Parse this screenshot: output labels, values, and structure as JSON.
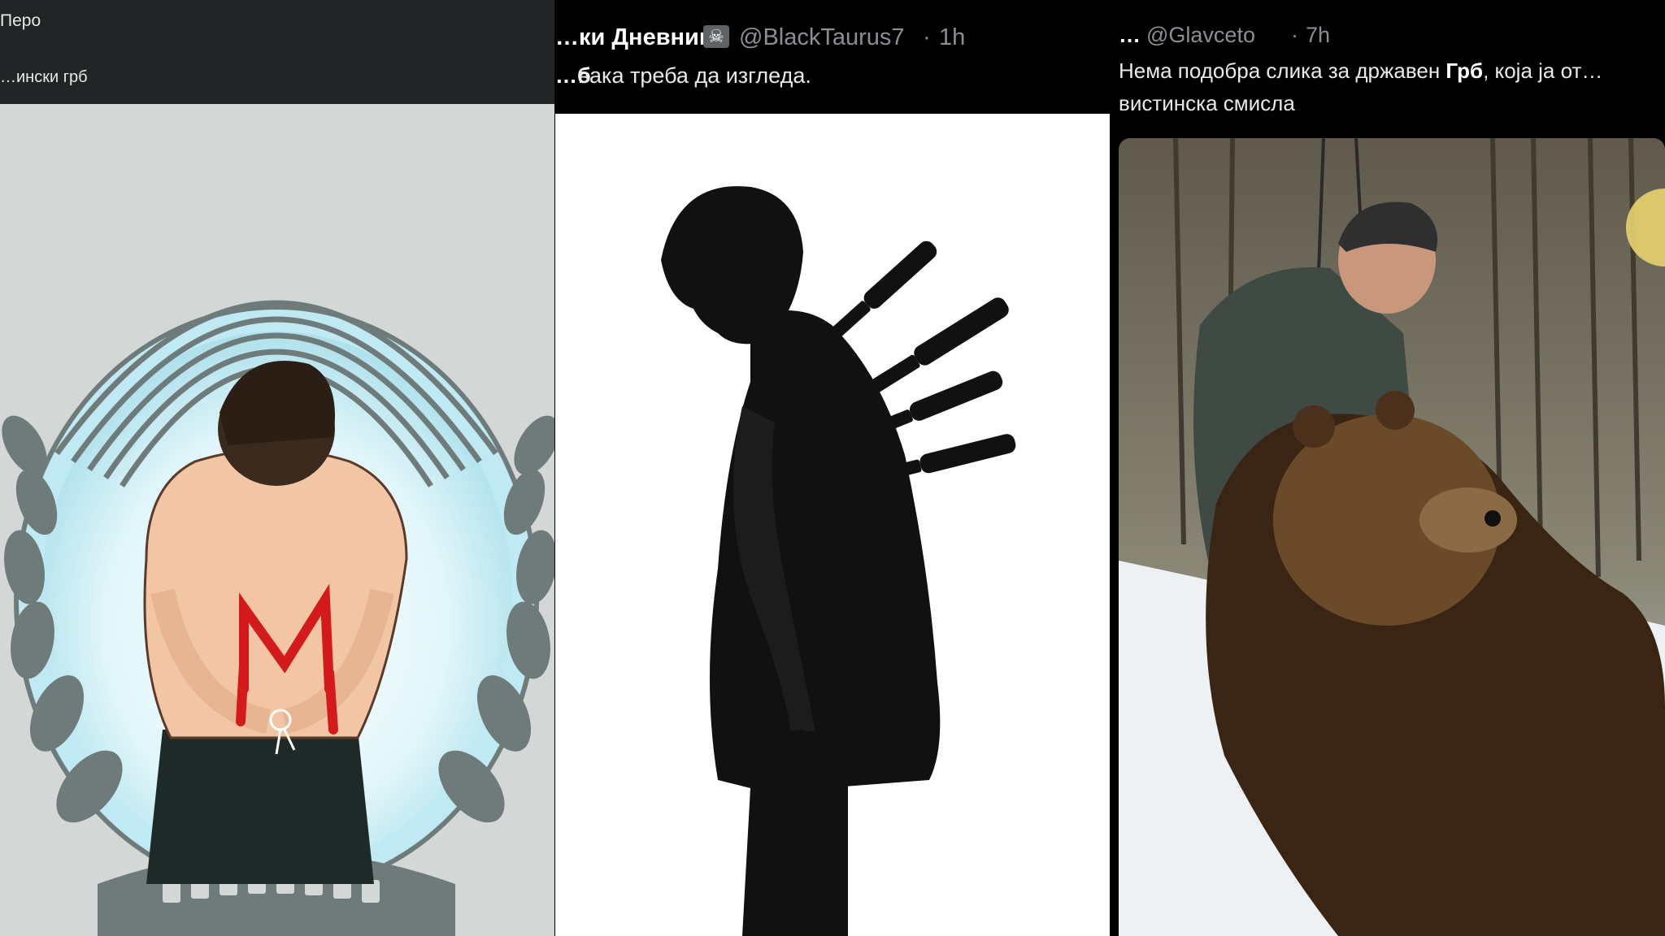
{
  "panels": [
    {
      "author_name": "Перо",
      "text": "…ински грб",
      "image": {
        "subject": "drawing of shirtless man, bound hands, red M on back, inside wheat wreath emblem"
      }
    },
    {
      "author_name": "…ки Дневник",
      "author_icon": "skull-crossbones-icon",
      "handle": "@BlackTaurus7",
      "time_sep": "·",
      "time": "1h",
      "text_bold": "…б",
      "text": "вака треба да изгледа.",
      "image": {
        "subject": "silhouette of bowing man in suit with knives in back"
      }
    },
    {
      "author_name": "…",
      "handle": "@Glavceto",
      "time_sep": "·",
      "time": "7h",
      "text_line1_pre": "Нема подобра слика за државен ",
      "text_line1_bold": "Грб",
      "text_line1_post": ", која ја от…",
      "text_line2": "вистинска смисла",
      "image": {
        "subject": "hunter posing with brown bear in snowy forest"
      }
    }
  ],
  "colors": {
    "header_dark": "#222526",
    "muted": "#8b8f94",
    "blood": "#d41a1a",
    "emblem_gray": "#6f7b7a",
    "emblem_glow": "#bfe9f3"
  }
}
